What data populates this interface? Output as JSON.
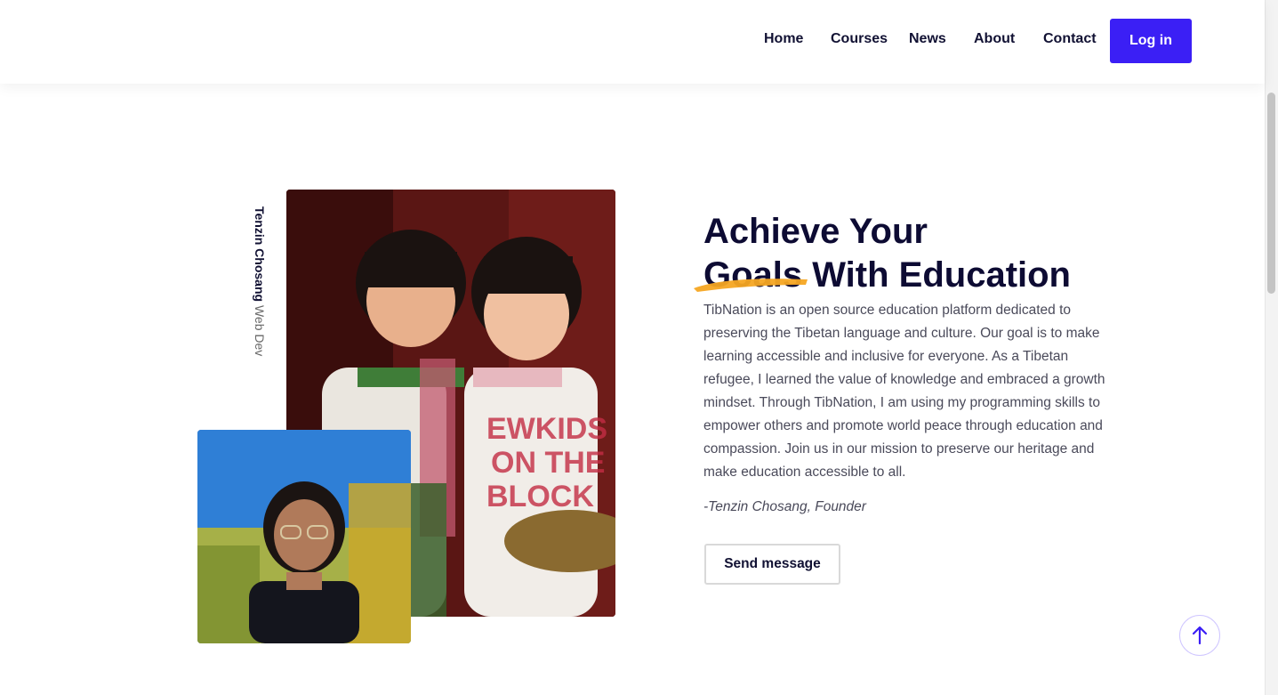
{
  "nav": {
    "items": [
      "Home",
      "Courses",
      "News",
      "About",
      "Contact"
    ],
    "login_label": "Log in"
  },
  "founder": {
    "name": "Tenzin Chosang",
    "role": "Web Dev"
  },
  "hero": {
    "headline_line1": "Achieve Your",
    "headline_line2": "Goals With Education",
    "paragraph": "TibNation is an open source education platform dedicated to preserving the Tibetan language and culture. Our goal is to make learning accessible and inclusive for everyone. As a Tibetan refugee, I learned the value of knowledge and embraced a growth mindset. Through TibNation, I am using my programming skills to empower others and promote world peace through education and compassion. Join us in our mission to preserve our heritage and make education accessible to all.",
    "quote": "-Tenzin Chosang, Founder",
    "send_label": "Send message"
  },
  "colors": {
    "accent": "#3b1ff5",
    "brush": "#f5a623",
    "heading": "#0d0b33"
  },
  "icons": {
    "scroll_top": "arrow-up-icon"
  }
}
